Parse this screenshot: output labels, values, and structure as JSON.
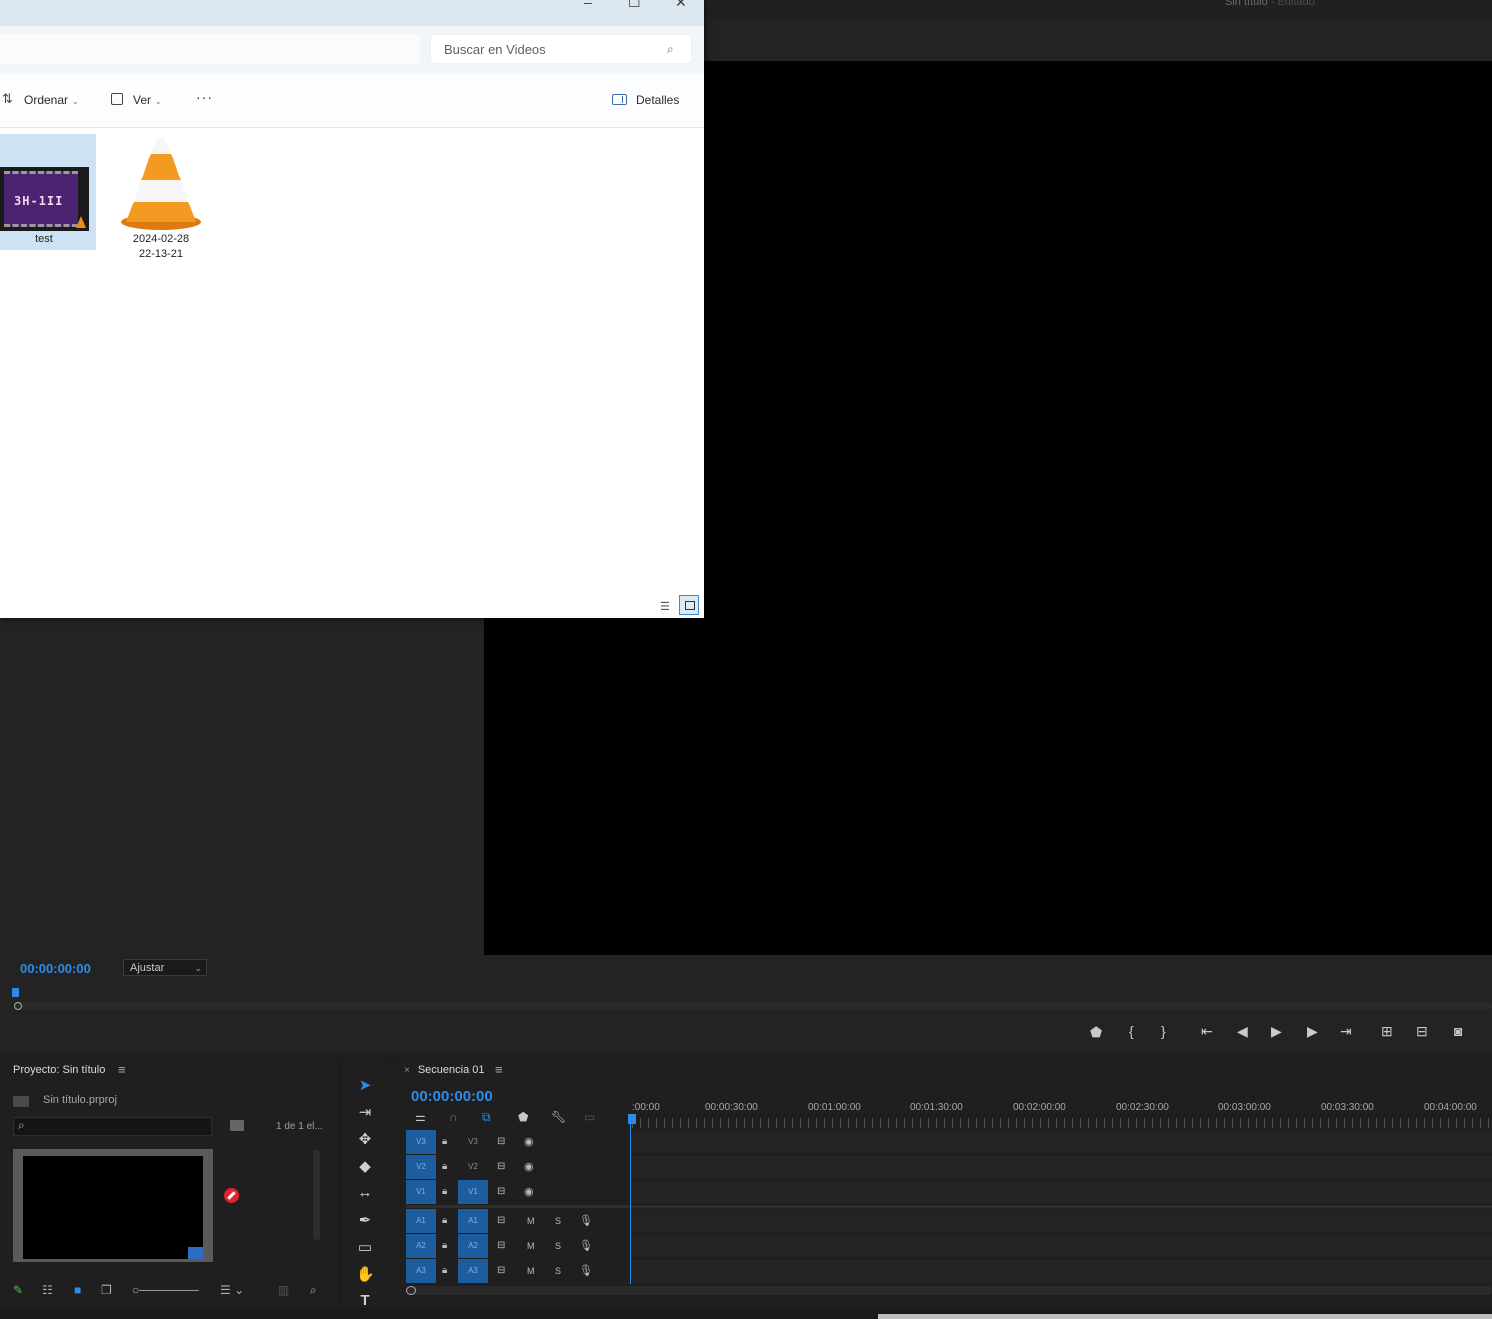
{
  "app": {
    "title": "Sin título",
    "title_suffix": " - Editado"
  },
  "explorer": {
    "search_placeholder": "Buscar en Videos",
    "toolbar": {
      "sort_label": "Ordenar",
      "view_label": "Ver",
      "more_label": "···",
      "details_label": "Detalles"
    },
    "files": [
      {
        "name": "test",
        "icon": "video-thumbnail",
        "thumb_text": "3H-1II",
        "selected": true
      },
      {
        "name_line1": "2024-02-28",
        "name_line2": "22-13-21",
        "icon": "vlc-cone-icon"
      }
    ],
    "window_buttons": [
      "–",
      "☐",
      "✕"
    ]
  },
  "program_monitor": {
    "timecode": "00:00:00:00",
    "fit_value": "Ajustar"
  },
  "project": {
    "title": "Proyecto: Sin título",
    "file_name": "Sin título.prproj",
    "item_count": "1 de 1 el...",
    "search_value": ""
  },
  "timeline": {
    "sequence_name": "Secuencia 01",
    "close_label": "×",
    "timecode": "00:00:00:00",
    "ruler": [
      ":00:00",
      "00:00:30:00",
      "00:01:00:00",
      "00:01:30:00",
      "00:02:00:00",
      "00:02:30:00",
      "00:03:00:00",
      "00:03:30:00",
      "00:04:00:00"
    ],
    "video_tracks": [
      {
        "target": "V3",
        "name": "V3",
        "name_targeted": false
      },
      {
        "target": "V2",
        "name": "V2",
        "name_targeted": false
      },
      {
        "target": "V1",
        "name": "V1",
        "name_targeted": true
      }
    ],
    "audio_tracks": [
      {
        "target": "A1",
        "name": "A1",
        "mute": "M",
        "solo": "S"
      },
      {
        "target": "A2",
        "name": "A2",
        "mute": "M",
        "solo": "S"
      },
      {
        "target": "A3",
        "name": "A3",
        "mute": "M",
        "solo": "S"
      }
    ]
  },
  "colors": {
    "accent": "#2d8ceb",
    "track_target": "#1d5c9d",
    "panel_bg": "#1f1f1f"
  }
}
